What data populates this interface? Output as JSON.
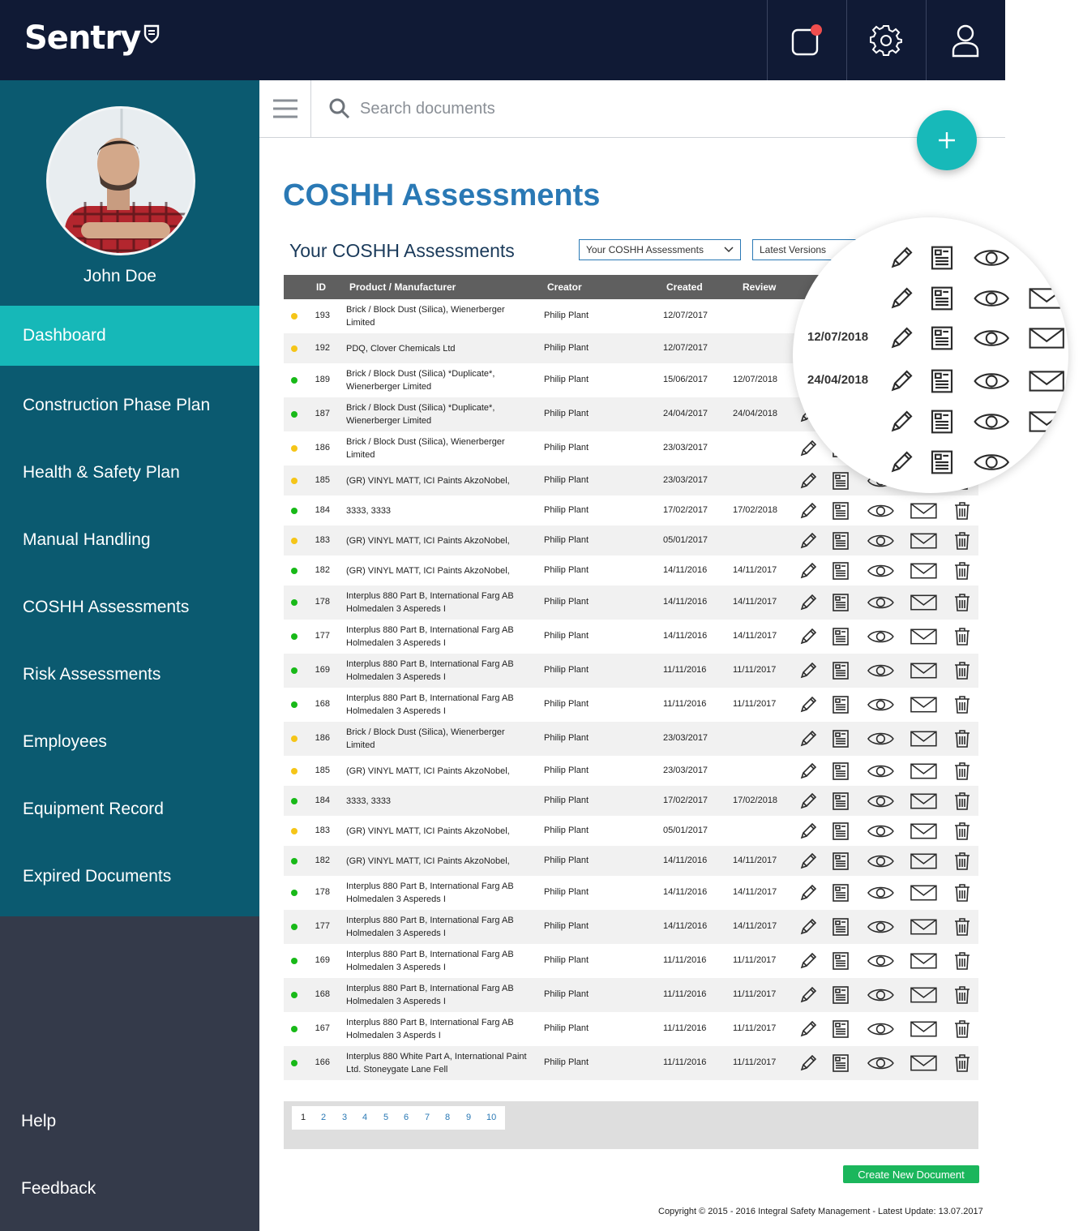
{
  "app": {
    "name": "Sentry"
  },
  "user": {
    "name": "John Doe"
  },
  "sidebar": {
    "items": [
      {
        "label": "Dashboard"
      },
      {
        "label": "Construction Phase Plan"
      },
      {
        "label": "Health & Safety Plan"
      },
      {
        "label": "Manual Handling"
      },
      {
        "label": "COSHH Assessments"
      },
      {
        "label": "Risk Assessments"
      },
      {
        "label": "Employees"
      },
      {
        "label": "Equipment Record"
      },
      {
        "label": "Expired Documents"
      }
    ],
    "footer": [
      {
        "label": "Help"
      },
      {
        "label": "Feedback"
      }
    ]
  },
  "search": {
    "placeholder": "Search documents"
  },
  "page": {
    "title": "COSHH Assessments",
    "section_title": "Your COSHH Assessments",
    "filter_select": "Your COSHH Assessments",
    "version_select": "Latest Versions"
  },
  "table": {
    "headers": [
      "ID",
      "Product / Manufacturer",
      "Creator",
      "Created",
      "Review"
    ],
    "rows": [
      {
        "status": "yellow",
        "id": "193",
        "product": "Brick / Block Dust (Silica), Wienerberger Limited",
        "creator": "Philip Plant",
        "created": "12/07/2017",
        "review": ""
      },
      {
        "status": "yellow",
        "id": "192",
        "product": "PDQ, Clover Chemicals Ltd",
        "creator": "Philip Plant",
        "created": "12/07/2017",
        "review": ""
      },
      {
        "status": "green",
        "id": "189",
        "product": "Brick / Block Dust (Silica) *Duplicate*, Wienerberger Limited",
        "creator": "Philip Plant",
        "created": "15/06/2017",
        "review": "12/07/2018"
      },
      {
        "status": "green",
        "id": "187",
        "product": "Brick / Block Dust (Silica) *Duplicate*, Wienerberger Limited",
        "creator": "Philip Plant",
        "created": "24/04/2017",
        "review": "24/04/2018"
      },
      {
        "status": "yellow",
        "id": "186",
        "product": "Brick / Block Dust (Silica), Wienerberger Limited",
        "creator": "Philip Plant",
        "created": "23/03/2017",
        "review": ""
      },
      {
        "status": "yellow",
        "id": "185",
        "product": "(GR) VINYL MATT, ICI Paints AkzoNobel,",
        "creator": "Philip Plant",
        "created": "23/03/2017",
        "review": ""
      },
      {
        "status": "green",
        "id": "184",
        "product": "3333, 3333",
        "creator": "Philip Plant",
        "created": "17/02/2017",
        "review": "17/02/2018"
      },
      {
        "status": "yellow",
        "id": "183",
        "product": "(GR) VINYL MATT, ICI Paints AkzoNobel,",
        "creator": "Philip Plant",
        "created": "05/01/2017",
        "review": ""
      },
      {
        "status": "green",
        "id": "182",
        "product": "(GR) VINYL MATT, ICI Paints AkzoNobel,",
        "creator": "Philip Plant",
        "created": "14/11/2016",
        "review": "14/11/2017"
      },
      {
        "status": "green",
        "id": "178",
        "product": "Interplus 880 Part B, International Farg AB Holmedalen 3 Aspereds I",
        "creator": "Philip Plant",
        "created": "14/11/2016",
        "review": "14/11/2017"
      },
      {
        "status": "green",
        "id": "177",
        "product": "Interplus 880 Part B, International Farg AB Holmedalen 3 Aspereds I",
        "creator": "Philip Plant",
        "created": "14/11/2016",
        "review": "14/11/2017"
      },
      {
        "status": "green",
        "id": "169",
        "product": "Interplus 880 Part B, International Farg AB Holmedalen 3 Aspereds I",
        "creator": "Philip Plant",
        "created": "11/11/2016",
        "review": "11/11/2017"
      },
      {
        "status": "green",
        "id": "168",
        "product": "Interplus 880 Part B, International Farg AB Holmedalen 3 Aspereds I",
        "creator": "Philip Plant",
        "created": "11/11/2016",
        "review": "11/11/2017"
      },
      {
        "status": "yellow",
        "id": "186",
        "product": "Brick / Block Dust (Silica), Wienerberger Limited",
        "creator": "Philip Plant",
        "created": "23/03/2017",
        "review": ""
      },
      {
        "status": "yellow",
        "id": "185",
        "product": "(GR) VINYL MATT, ICI Paints AkzoNobel,",
        "creator": "Philip Plant",
        "created": "23/03/2017",
        "review": ""
      },
      {
        "status": "green",
        "id": "184",
        "product": "3333, 3333",
        "creator": "Philip Plant",
        "created": "17/02/2017",
        "review": "17/02/2018"
      },
      {
        "status": "yellow",
        "id": "183",
        "product": "(GR) VINYL MATT, ICI Paints AkzoNobel,",
        "creator": "Philip Plant",
        "created": "05/01/2017",
        "review": ""
      },
      {
        "status": "green",
        "id": "182",
        "product": "(GR) VINYL MATT, ICI Paints AkzoNobel,",
        "creator": "Philip Plant",
        "created": "14/11/2016",
        "review": "14/11/2017"
      },
      {
        "status": "green",
        "id": "178",
        "product": "Interplus 880 Part B, International Farg AB Holmedalen 3 Aspereds I",
        "creator": "Philip Plant",
        "created": "14/11/2016",
        "review": "14/11/2017"
      },
      {
        "status": "green",
        "id": "177",
        "product": "Interplus 880 Part B, International Farg AB Holmedalen 3 Aspereds I",
        "creator": "Philip Plant",
        "created": "14/11/2016",
        "review": "14/11/2017"
      },
      {
        "status": "green",
        "id": "169",
        "product": "Interplus 880 Part B, International Farg AB Holmedalen 3 Aspereds I",
        "creator": "Philip Plant",
        "created": "11/11/2016",
        "review": "11/11/2017"
      },
      {
        "status": "green",
        "id": "168",
        "product": "Interplus 880 Part B, International Farg AB Holmedalen 3 Aspereds I",
        "creator": "Philip Plant",
        "created": "11/11/2016",
        "review": "11/11/2017"
      },
      {
        "status": "green",
        "id": "167",
        "product": "Interplus 880 Part B, International Farg AB Holmedalen 3 Asperds I",
        "creator": "Philip Plant",
        "created": "11/11/2016",
        "review": "11/11/2017"
      },
      {
        "status": "green",
        "id": "166",
        "product": "Interplus 880 White Part A, International Paint Ltd. Stoneygate Lane Fell",
        "creator": "Philip Plant",
        "created": "11/11/2016",
        "review": "11/11/2017"
      }
    ],
    "row_actions": [
      "pencil-icon",
      "document-icon",
      "eye-icon",
      "envelope-icon",
      "trash-icon"
    ]
  },
  "magnifier": {
    "dates": [
      "12/07/2018",
      "24/04/2018"
    ]
  },
  "pagination": {
    "pages": [
      "1",
      "2",
      "3",
      "4",
      "5",
      "6",
      "7",
      "8",
      "9",
      "10"
    ],
    "current": "1"
  },
  "footer": {
    "create_button": "Create New Document",
    "copyright": "Copyright © 2015 - 2016 Integral Safety Management - Latest Update: 13.07.2017"
  },
  "colors": {
    "topbar": "#101a35",
    "sidebar": "#0b5a70",
    "sidebar_active": "#16b8b8",
    "sidebar_footer": "#343a4a",
    "accent": "#17b9b9",
    "title": "#2a79b5",
    "status_green": "#18b918",
    "status_yellow": "#f5c518",
    "create_button": "#1bb65c",
    "notification": "#f04e4e"
  }
}
